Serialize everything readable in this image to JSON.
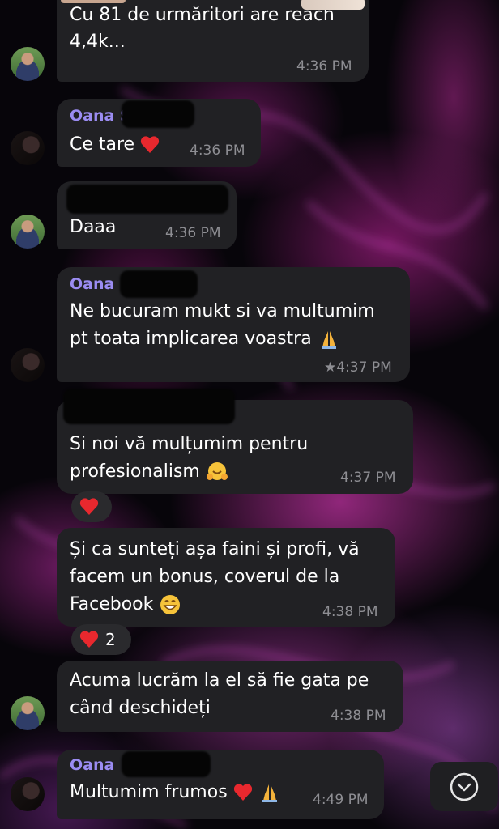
{
  "messages": [
    {
      "id": "m1",
      "lines": [
        "Cu 81 de urmăritori are reach",
        "4,4k..."
      ],
      "time": "4:36 PM"
    },
    {
      "id": "m2",
      "sender": "Oana S",
      "text": "Ce tare",
      "time": "4:36 PM"
    },
    {
      "id": "m3",
      "text": "Daaa",
      "time": "4:36 PM"
    },
    {
      "id": "m4",
      "sender": "Oana",
      "lines": [
        "Ne bucuram mukt si va multumim",
        "pt toata implicarea voastra"
      ],
      "time": "★4:37 PM"
    },
    {
      "id": "m5",
      "lines": [
        "Si noi vă mulțumim pentru",
        "profesionalism"
      ],
      "time": "4:37 PM"
    },
    {
      "id": "m6",
      "lines": [
        "Și ca sunteți așa faini și profi, vă",
        "facem un bonus, coverul de la",
        "Facebook"
      ],
      "time": "4:38 PM",
      "reaction_count": "2"
    },
    {
      "id": "m7",
      "lines": [
        "Acuma lucrăm la el să fie gata pe",
        "când deschideți"
      ],
      "time": "4:38 PM"
    },
    {
      "id": "m8",
      "sender": "Oana",
      "text": "Multumim frumos",
      "time": "4:49 PM"
    }
  ],
  "icons": {
    "heart": "red-heart-icon",
    "praying_hands": "folded-hands-icon",
    "hug": "hugging-face-icon",
    "grin": "grinning-face-icon",
    "scroll_down": "chevron-down-icon"
  },
  "colors": {
    "bubble": "#212124",
    "sender_name": "#9b8cf2",
    "timestamp": "#8e8e93",
    "heart": "#e8282e"
  }
}
